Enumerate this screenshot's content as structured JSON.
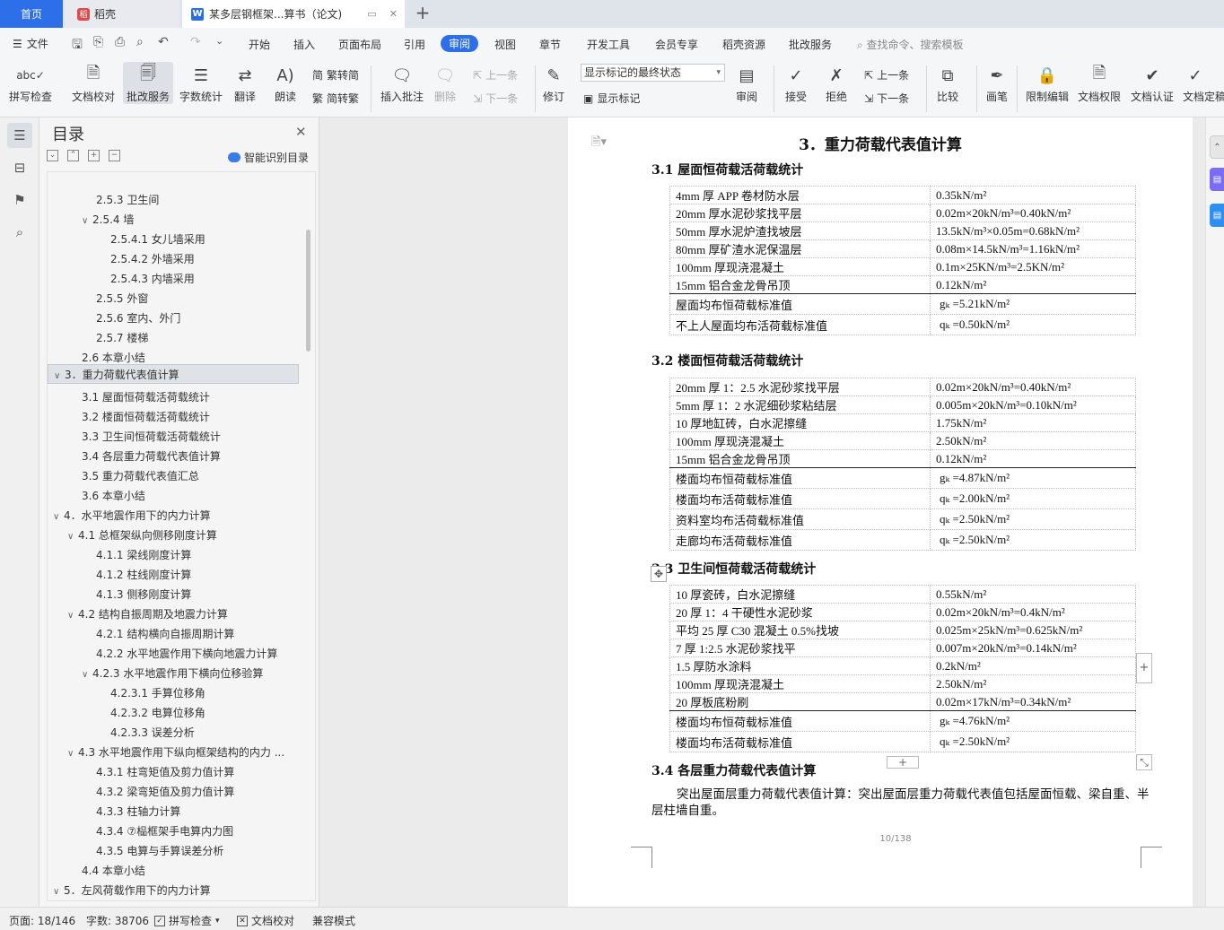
{
  "tabs": {
    "home": "首页",
    "daoke": "稻壳",
    "doc": "某多层钢框架...算书（论文)",
    "new_tab": "+"
  },
  "menu": {
    "file": "文件",
    "tabs": [
      "开始",
      "插入",
      "页面布局",
      "引用",
      "审阅",
      "视图",
      "章节",
      "开发工具",
      "会员专享",
      "稻壳资源",
      "批改服务"
    ],
    "active_tab": "审阅",
    "search_placeholder": "查找命令、搜索模板"
  },
  "ribbon": {
    "spell_check": "拼写检查",
    "doc_proof": "文档校对",
    "correction": "批改服务",
    "word_count": "字数统计",
    "translate": "翻译",
    "read_aloud": "朗读",
    "trad_to_simp": "繁转简",
    "simp_to_trad": "简转繁",
    "insert_comment": "插入批注",
    "delete": "删除",
    "prev": "上一条",
    "next": "下一条",
    "track": "修订",
    "markup_select": "显示标记的最终状态",
    "show_markup": "显示标记",
    "review": "审阅",
    "accept": "接受",
    "reject": "拒绝",
    "prev2": "上一条",
    "next2": "下一条",
    "compare": "比较",
    "pen": "画笔",
    "restrict": "限制编辑",
    "doc_rights": "文档权限",
    "doc_cert": "文档认证",
    "doc_final": "文档定稿"
  },
  "toc": {
    "title": "目录",
    "smart": "智能识别目录",
    "items": [
      "2.5.3  卫生间",
      "2.5.4 墙",
      "2.5.4.1 女儿墙采用",
      "2.5.4.2 外墙采用",
      "2.5.4.3 内墙采用",
      "2.5.5 外窗",
      "2.5.6 室内、外门",
      "2.5.7 楼梯",
      "2.6 本章小结",
      "3．重力荷载代表值计算",
      "3.1  屋面恒荷载活荷载统计",
      "3.2  楼面恒荷载活荷载统计",
      "3.3 卫生间恒荷载活荷载统计",
      "3.4  各层重力荷载代表值计算",
      "3.5  重力荷载代表值汇总",
      "3.6 本章小结",
      "4．水平地震作用下的内力计算",
      "4.1    总框架纵向侧移刚度计算",
      "4.1.1 梁线刚度计算",
      "4.1.2 柱线刚度计算",
      "4.1.3 侧移刚度计算",
      "4.2 结构自振周期及地震力计算",
      "4.2.1 结构横向自振周期计算",
      "4.2.2 水平地震作用下横向地震力计算",
      "4.2.3 水平地震作用下横向位移验算",
      "4.2.3.1  手算位移角",
      "4.2.3.2  电算位移角",
      "4.2.3.3  误差分析",
      "4.3 水平地震作用下纵向框架结构的内力 ...",
      "4.3.1 柱弯矩值及剪力值计算",
      "4.3.2 梁弯矩值及剪力值计算",
      "4.3.3 柱轴力计算",
      "4.3.4  ⑦榀框架手电算内力图",
      "4.3.5 电算与手算误差分析",
      "4.4 本章小结",
      "5．左风荷载作用下的内力计算"
    ]
  },
  "doc": {
    "h1": "3．重力荷载代表值计算",
    "s31": "3.1  屋面恒荷载活荷载统计",
    "s32": "3.2  楼面恒荷载活荷载统计",
    "s33": "3.3  卫生间恒荷载活荷载统计",
    "s34": "3.4  各层重力荷载代表值计算",
    "t1": [
      [
        "4mm 厚 APP 卷材防水层",
        "0.35kN/m²"
      ],
      [
        "20mm 厚水泥砂浆找平层",
        "0.02m×20kN/m³=0.40kN/m²"
      ],
      [
        "50mm 厚水泥炉渣找坡层",
        "13.5kN/m³×0.05m=0.68kN/m²"
      ],
      [
        "80mm 厚矿渣水泥保温层",
        "0.08m×14.5kN/m³=1.16kN/m²"
      ],
      [
        "100mm 厚现浇混凝土",
        "0.1m×25KN/m³=2.5KN/m²"
      ],
      [
        "15mm 铝合金龙骨吊顶",
        "0.12kN/m²"
      ],
      [
        "屋面均布恒荷载标准值",
        "gₖ =5.21kN/m²"
      ],
      [
        "不上人屋面均布活荷载标准值",
        "qₖ =0.50kN/m²"
      ]
    ],
    "t2": [
      [
        "20mm 厚 1：2.5 水泥砂浆找平层",
        "0.02m×20kN/m³=0.40kN/m²"
      ],
      [
        "5mm 厚 1：2 水泥细砂浆粘结层",
        "0.005m×20kN/m³=0.10kN/m²"
      ],
      [
        "10 厚地缸砖，白水泥擦缝",
        "1.75kN/m²"
      ],
      [
        "100mm 厚现浇混凝土",
        "2.50kN/m²"
      ],
      [
        "15mm 铝合金龙骨吊顶",
        "0.12kN/m²"
      ],
      [
        "楼面均布恒荷载标准值",
        "gₖ =4.87kN/m²"
      ],
      [
        "楼面均布活荷载标准值",
        "qₖ =2.00kN/m²"
      ],
      [
        "资料室均布活荷载标准值",
        "qₖ =2.50kN/m²"
      ],
      [
        "走廊均布活荷载标准值",
        "qₖ =2.50kN/m²"
      ]
    ],
    "t3": [
      [
        "10 厚瓷砖，白水泥擦缝",
        "0.55kN/m²"
      ],
      [
        "20 厚 1：4 干硬性水泥砂浆",
        "0.02m×20kN/m³=0.4kN/m²"
      ],
      [
        "平均 25 厚 C30 混凝土 0.5%找坡",
        "0.025m×25kN/m³=0.625kN/m²"
      ],
      [
        "7 厚 1:2.5 水泥砂浆找平",
        "0.007m×20kN/m³=0.14kN/m²"
      ],
      [
        "1.5 厚防水涂料",
        "0.2kN/m²"
      ],
      [
        "100mm 厚现浇混凝土",
        "2.50kN/m²"
      ],
      [
        "20 厚板底粉刷",
        "0.02m×17kN/m³=0.34kN/m²"
      ],
      [
        "楼面均布恒荷载标准值",
        "gₖ =4.76kN/m²"
      ],
      [
        "楼面均布活荷载标准值",
        "qₖ =2.50kN/m²"
      ]
    ],
    "para": "突出屋面层重力荷载代表值计算：突出屋面层重力荷载代表值包括屋面恒载、梁自重、半层柱墙自重。",
    "page_num": "10/138"
  },
  "status": {
    "page": "页面: 18/146",
    "words": "字数: 38706",
    "spell": "拼写检查",
    "proof": "文档校对",
    "compat": "兼容模式"
  },
  "colors": {
    "accent": "#2d6fe8",
    "brand_red": "#e34747"
  }
}
